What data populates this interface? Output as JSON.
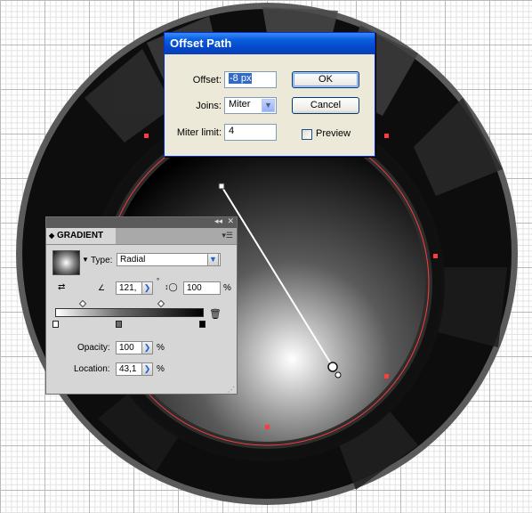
{
  "offset_dialog": {
    "title": "Offset Path",
    "offset_label": "Offset:",
    "offset_value": "-8 px",
    "joins_label": "Joins:",
    "joins_value": "Miter",
    "miter_label": "Miter limit:",
    "miter_value": "4",
    "ok_label": "OK",
    "cancel_label": "Cancel",
    "preview_label": "Preview",
    "preview_checked": false
  },
  "gradient_panel": {
    "tab_label": "GRADIENT",
    "type_label": "Type:",
    "type_value": "Radial",
    "angle_value": "121,",
    "aspect_value": "100",
    "aspect_unit": "%",
    "opacity_label": "Opacity:",
    "opacity_value": "100",
    "opacity_unit": "%",
    "location_label": "Location:",
    "location_value": "43,1",
    "location_unit": "%",
    "icons": [
      "reverse-gradient-icon",
      "angle-icon",
      "aspect-ratio-icon",
      "delete-stop-icon",
      "panel-menu-icon"
    ]
  },
  "colors": {
    "selection_path": "#ff3b3b",
    "xp_title_blue": "#0a5fe0",
    "dial_dark": "#0d0d0d"
  }
}
